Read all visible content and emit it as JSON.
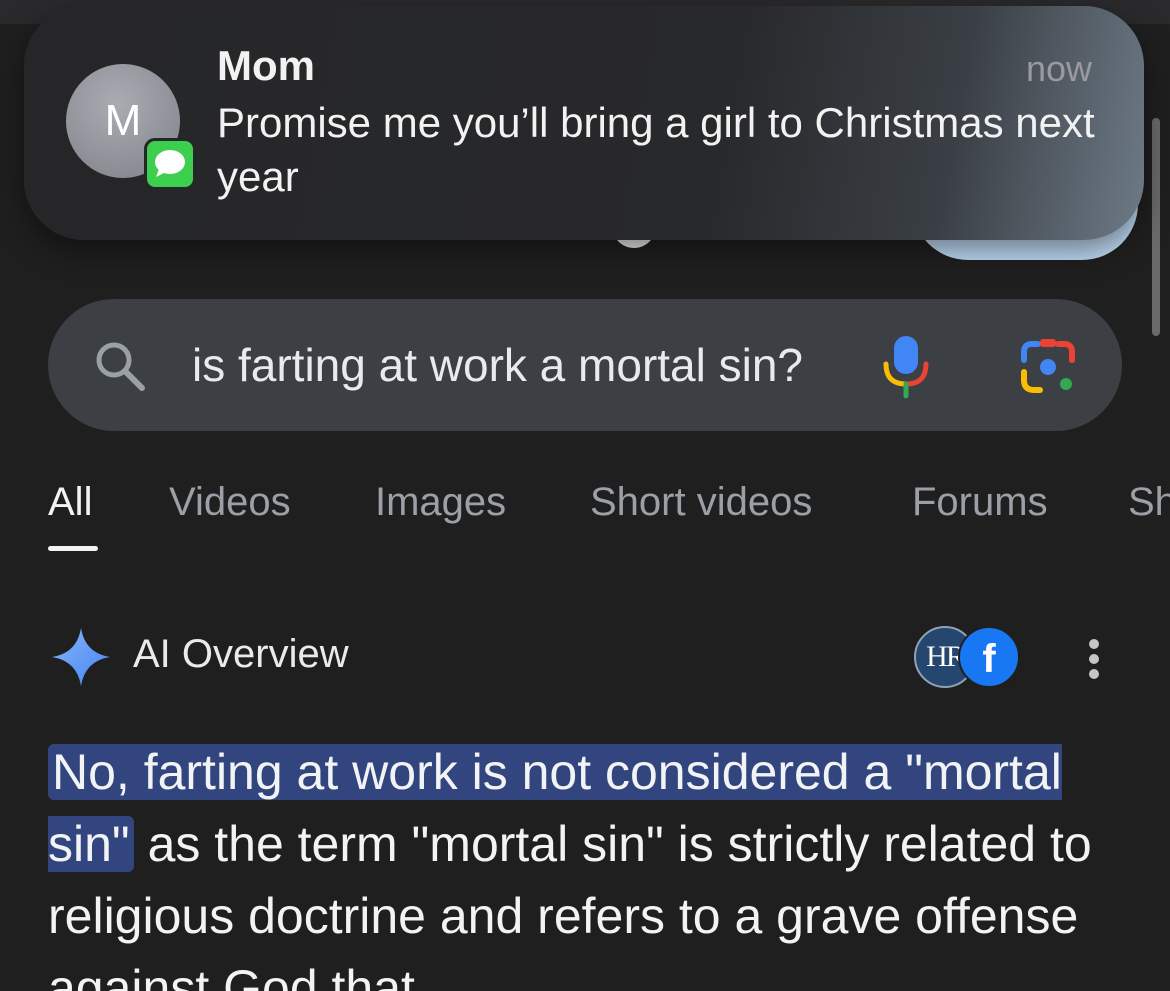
{
  "notification": {
    "avatar_initial": "M",
    "sender": "Mom",
    "time": "now",
    "message": "Promise me you’ll bring a girl to Christmas next year",
    "app_icon": "messages-icon",
    "app_color": "#3ccf4e"
  },
  "search": {
    "query": "is farting at work a mortal sin?",
    "icons": [
      "search-icon",
      "microphone-icon",
      "google-lens-icon"
    ]
  },
  "tabs": [
    {
      "label": "All",
      "active": true
    },
    {
      "label": "Videos",
      "active": false
    },
    {
      "label": "Images",
      "active": false
    },
    {
      "label": "Short videos",
      "active": false
    },
    {
      "label": "Forums",
      "active": false
    },
    {
      "label": "Sh",
      "active": false
    }
  ],
  "ai_overview": {
    "title": "AI Overview",
    "icon": "sparkle-icon",
    "sources": [
      {
        "label": "HR",
        "icon": "hr-source-icon"
      },
      {
        "label": "f",
        "icon": "facebook-icon"
      }
    ],
    "answer_highlight": "No, farting at work is not considered a \"mortal sin\"",
    "answer_rest": " as the term \"mortal sin\" is strictly related to religious doctrine and refers to a grave offense against God that"
  },
  "colors": {
    "background": "#1f1f1f",
    "search_bar": "#3c3f43",
    "highlight": "#33457e",
    "accent_blue": "#4285f4"
  }
}
